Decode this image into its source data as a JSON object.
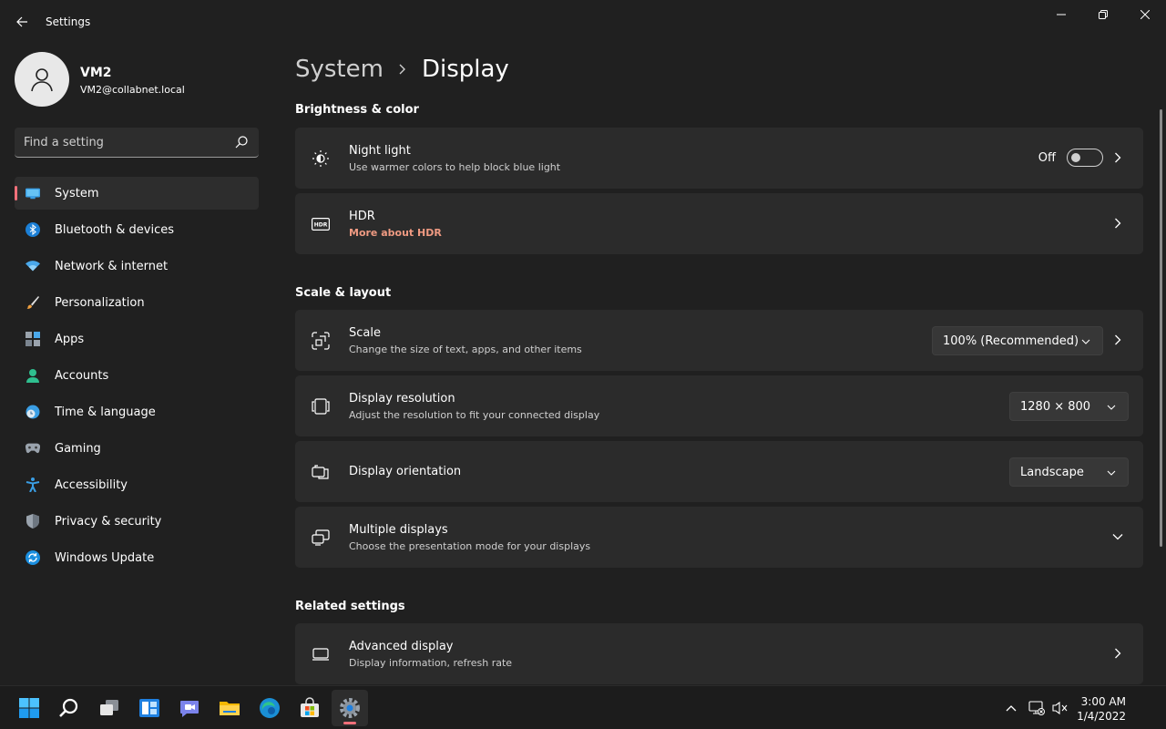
{
  "window": {
    "title": "Settings"
  },
  "user": {
    "name": "VM2",
    "email": "VM2@collabnet.local"
  },
  "search": {
    "placeholder": "Find a setting"
  },
  "nav": [
    {
      "label": "System",
      "icon": "system-icon",
      "active": true
    },
    {
      "label": "Bluetooth & devices",
      "icon": "bluetooth-icon"
    },
    {
      "label": "Network & internet",
      "icon": "wifi-icon"
    },
    {
      "label": "Personalization",
      "icon": "brush-icon"
    },
    {
      "label": "Apps",
      "icon": "apps-icon"
    },
    {
      "label": "Accounts",
      "icon": "person-icon"
    },
    {
      "label": "Time & language",
      "icon": "clock-globe-icon"
    },
    {
      "label": "Gaming",
      "icon": "gamepad-icon"
    },
    {
      "label": "Accessibility",
      "icon": "accessibility-icon"
    },
    {
      "label": "Privacy & security",
      "icon": "shield-icon"
    },
    {
      "label": "Windows Update",
      "icon": "update-icon"
    }
  ],
  "breadcrumb": {
    "parent": "System",
    "current": "Display"
  },
  "sections": {
    "brightness": "Brightness & color",
    "scale_layout": "Scale & layout",
    "related": "Related settings"
  },
  "cards": {
    "night_light": {
      "title": "Night light",
      "subtitle": "Use warmer colors to help block blue light",
      "toggle_label": "Off",
      "toggle_on": false
    },
    "hdr": {
      "title": "HDR",
      "link": "More about HDR"
    },
    "scale": {
      "title": "Scale",
      "subtitle": "Change the size of text, apps, and other items",
      "value": "100% (Recommended)"
    },
    "resolution": {
      "title": "Display resolution",
      "subtitle": "Adjust the resolution to fit your connected display",
      "value": "1280 × 800"
    },
    "orientation": {
      "title": "Display orientation",
      "value": "Landscape"
    },
    "multiple": {
      "title": "Multiple displays",
      "subtitle": "Choose the presentation mode for your displays"
    },
    "advanced": {
      "title": "Advanced display",
      "subtitle": "Display information, refresh rate"
    }
  },
  "taskbar": {
    "apps": [
      "start-icon",
      "search-icon",
      "task-view-icon",
      "widgets-icon",
      "teams-chat-icon",
      "file-explorer-icon",
      "edge-icon",
      "store-icon",
      "settings-icon"
    ],
    "time": "3:00 AM",
    "date": "1/4/2022"
  },
  "colors": {
    "accent": "#f1707a",
    "link": "#ef9a82",
    "background": "#202020",
    "card": "#2b2b2b"
  }
}
